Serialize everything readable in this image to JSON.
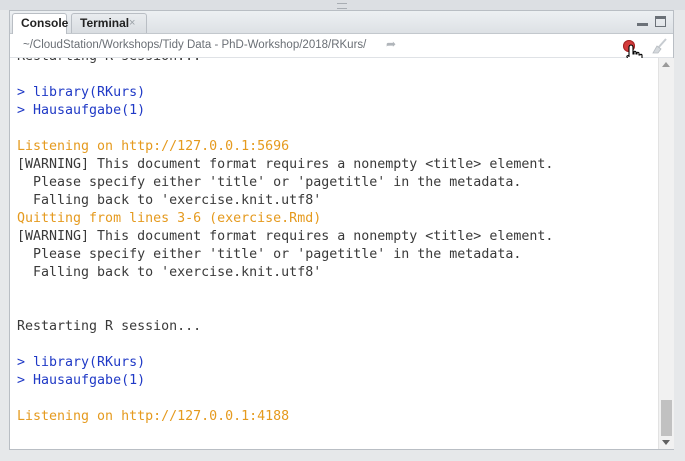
{
  "tabs": [
    {
      "label": "Console"
    },
    {
      "label": "Terminal",
      "close": "×"
    }
  ],
  "path": "~/CloudStation/Workshops/Tidy Data - PhD-Workshop/2018/RKurs/",
  "icons": {
    "path_go": "go-to-directory-icon",
    "stop": "stop-icon",
    "clear": "broom-icon",
    "minimize": "minimize-icon",
    "maximize": "maximize-icon"
  },
  "colors": {
    "command": "#1f39c6",
    "message": "#e59a1e",
    "output": "#3a3a3a",
    "stop": "#d33b3b"
  },
  "console_lines": [
    {
      "text": "Restarting R session...",
      "kind": "out"
    },
    {
      "text": "",
      "kind": "out"
    },
    {
      "text": "> library(RKurs)",
      "kind": "cmd"
    },
    {
      "text": "> Hausaufgabe(1)",
      "kind": "cmd"
    },
    {
      "text": "",
      "kind": "out"
    },
    {
      "text": "Listening on http://127.0.0.1:5696",
      "kind": "msg"
    },
    {
      "text": "[WARNING] This document format requires a nonempty <title> element.",
      "kind": "out"
    },
    {
      "text": "  Please specify either 'title' or 'pagetitle' in the metadata.",
      "kind": "out"
    },
    {
      "text": "  Falling back to 'exercise.knit.utf8'",
      "kind": "out"
    },
    {
      "text": "Quitting from lines 3-6 (exercise.Rmd)",
      "kind": "msg"
    },
    {
      "text": "[WARNING] This document format requires a nonempty <title> element.",
      "kind": "out"
    },
    {
      "text": "  Please specify either 'title' or 'pagetitle' in the metadata.",
      "kind": "out"
    },
    {
      "text": "  Falling back to 'exercise.knit.utf8'",
      "kind": "out"
    },
    {
      "text": "",
      "kind": "out"
    },
    {
      "text": "",
      "kind": "out"
    },
    {
      "text": "Restarting R session...",
      "kind": "out"
    },
    {
      "text": "",
      "kind": "out"
    },
    {
      "text": "> library(RKurs)",
      "kind": "cmd"
    },
    {
      "text": "> Hausaufgabe(1)",
      "kind": "cmd"
    },
    {
      "text": "",
      "kind": "out"
    },
    {
      "text": "Listening on http://127.0.0.1:4188",
      "kind": "msg"
    }
  ]
}
